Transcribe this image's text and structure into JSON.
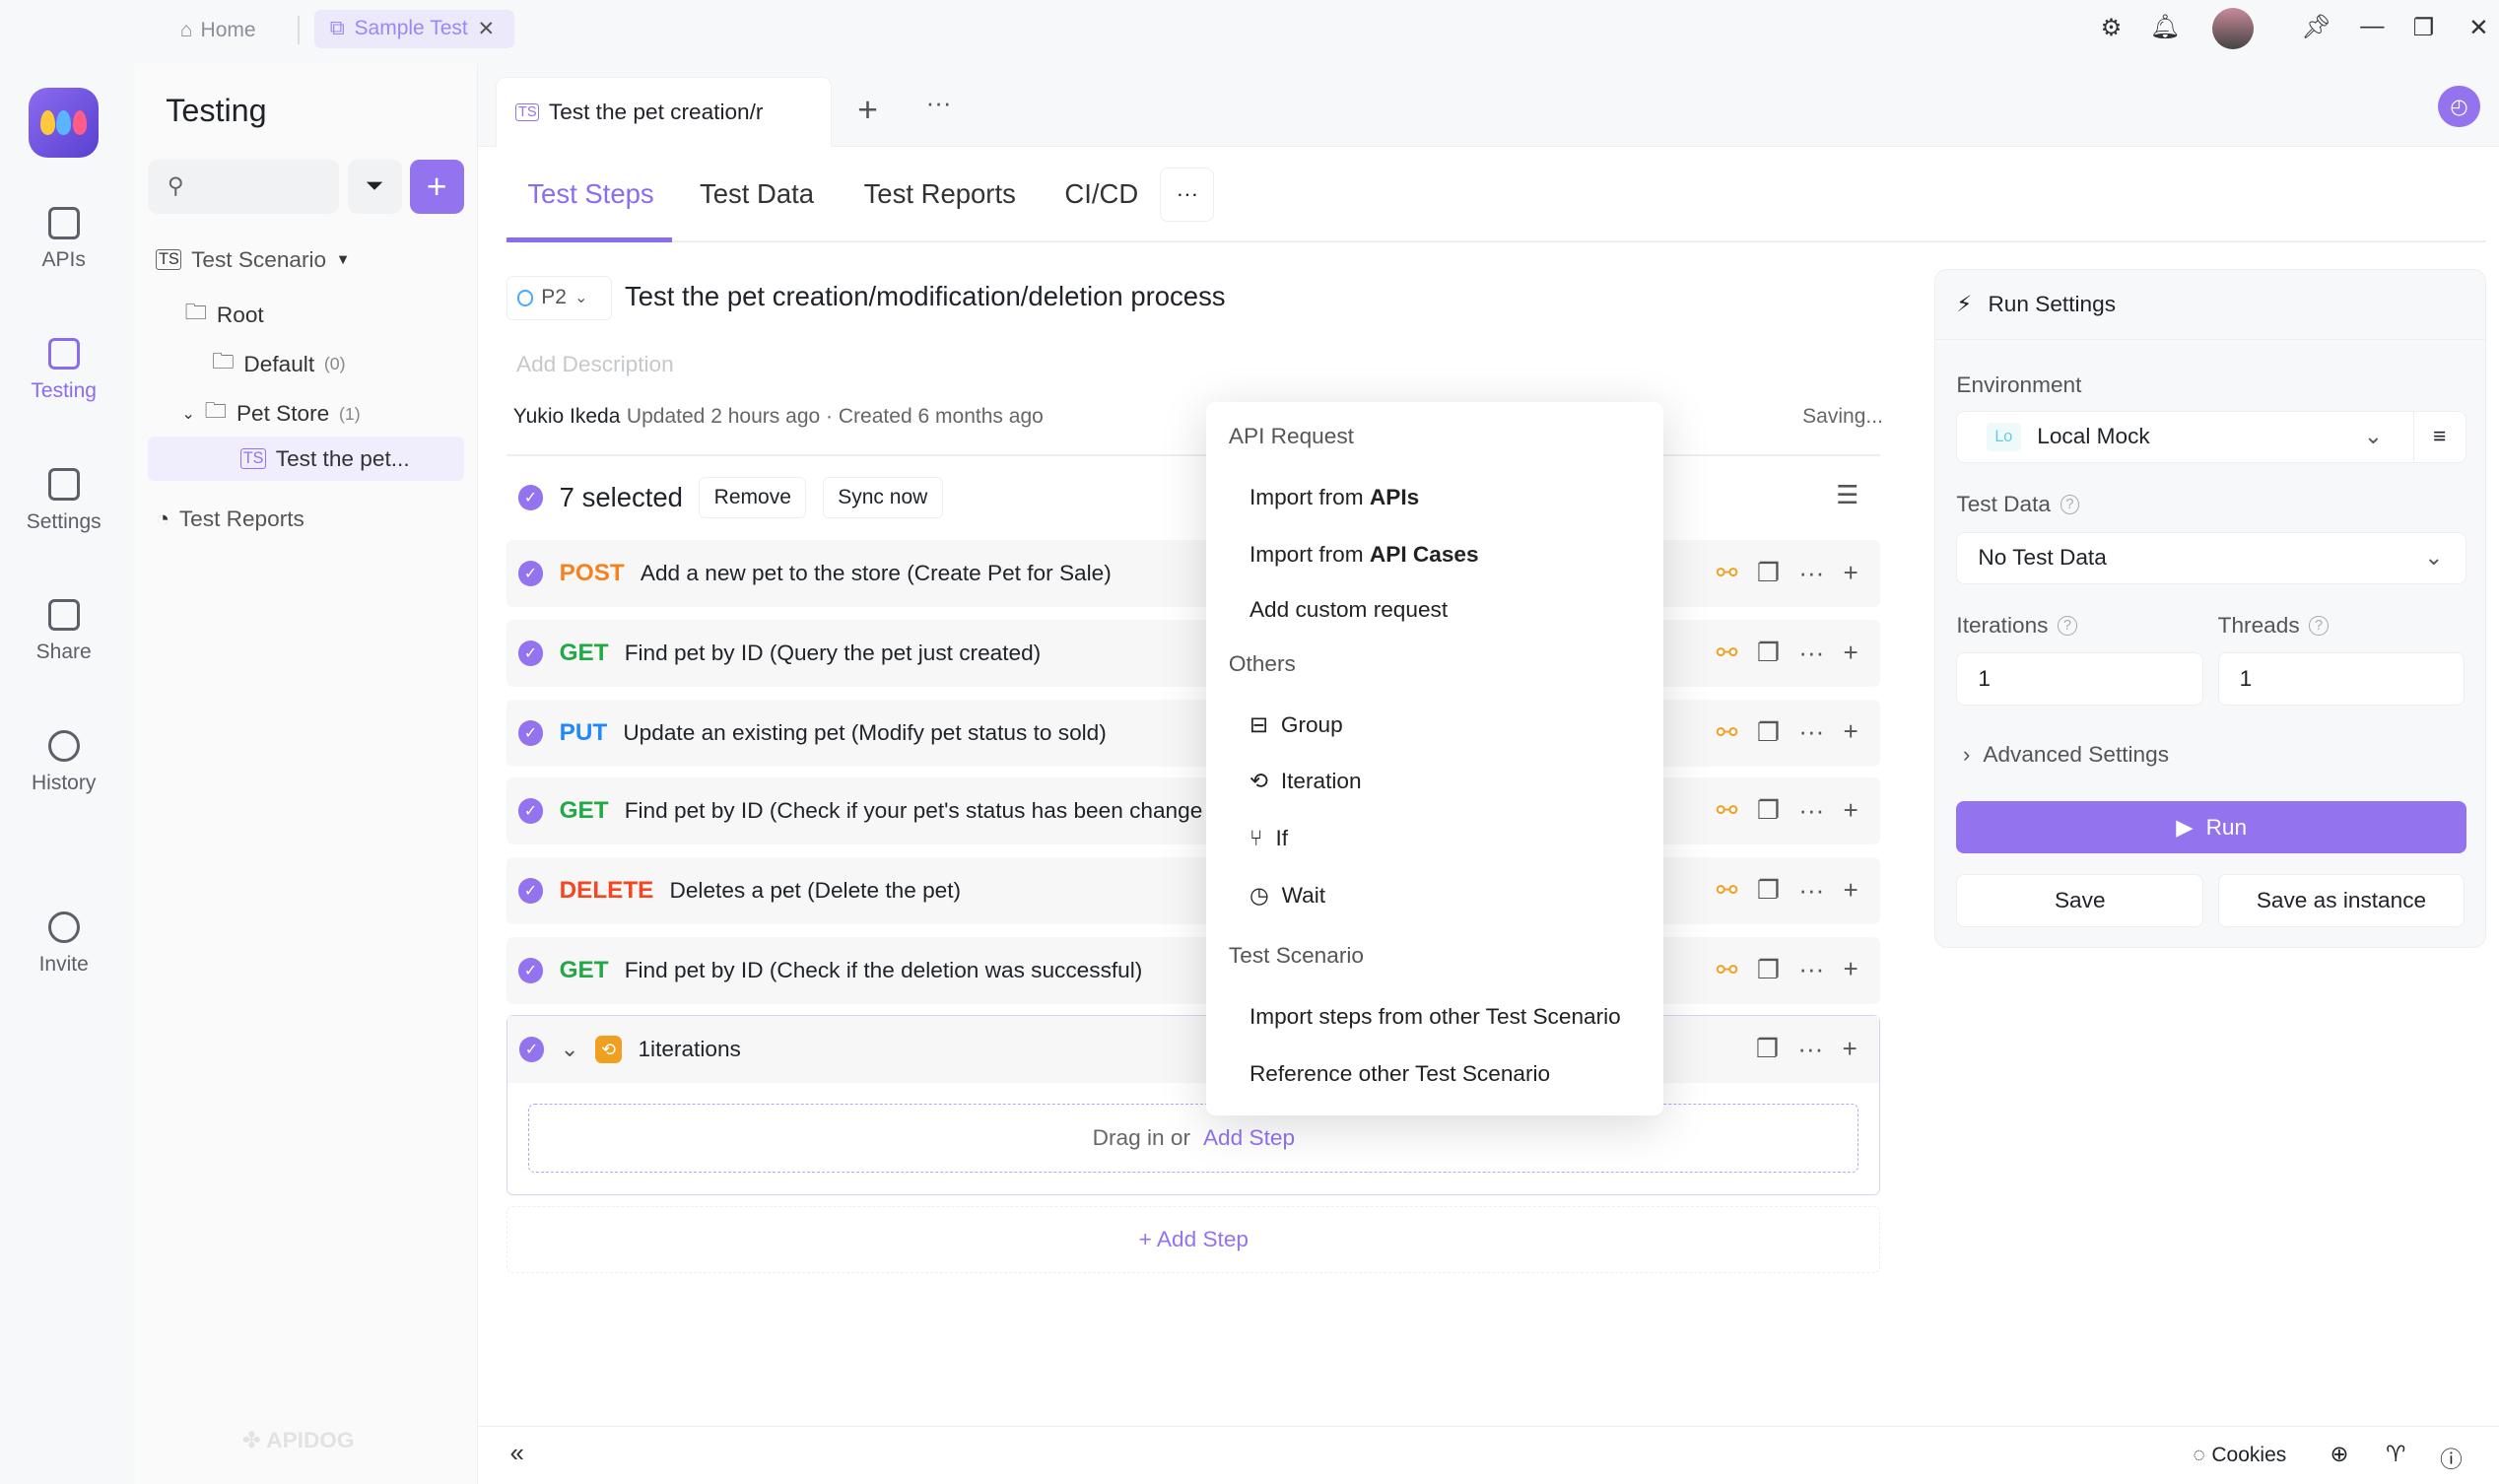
{
  "topbar": {
    "home_label": "Home",
    "open_tab": "Sample Test",
    "icons": [
      "settings-icon",
      "bell-icon",
      "avatar",
      "pin-icon",
      "minimize-icon",
      "restore-icon",
      "close-icon"
    ]
  },
  "rail": {
    "items": [
      {
        "label": "APIs",
        "icon": "apis-icon"
      },
      {
        "label": "Testing",
        "icon": "testing-icon",
        "active": true
      },
      {
        "label": "Settings",
        "icon": "settings-icon"
      },
      {
        "label": "Share",
        "icon": "share-icon"
      },
      {
        "label": "History",
        "icon": "history-icon"
      },
      {
        "label": "Invite",
        "icon": "invite-icon"
      }
    ]
  },
  "sidebar": {
    "title": "Testing",
    "search_placeholder": "",
    "tree": {
      "scenario": "Test Scenario",
      "root": "Root",
      "default": "Default",
      "default_count": "(0)",
      "petstore": "Pet Store",
      "petstore_count": "(1)",
      "selected": "Test the pet...",
      "reports": "Test Reports"
    },
    "watermark": "APIDOG"
  },
  "doc_tab": {
    "title": "Test the pet creation/r"
  },
  "subtabs": [
    "Test Steps",
    "Test Data",
    "Test Reports",
    "CI/CD"
  ],
  "scenario": {
    "priority": "P2",
    "title": "Test the pet creation/modification/deletion process",
    "description_placeholder": "Add Description",
    "author": "Yukio Ikeda",
    "updated": "Updated 2 hours ago · Created 6 months ago",
    "status": "Saving..."
  },
  "selection": {
    "count_label": "7 selected",
    "remove": "Remove",
    "sync": "Sync now"
  },
  "steps": [
    {
      "method": "POST",
      "color": "#f58220",
      "text": "Add a new pet to the store (Create Pet for Sale)"
    },
    {
      "method": "GET",
      "color": "#22a845",
      "text": "Find pet by ID (Query the pet just created)"
    },
    {
      "method": "PUT",
      "color": "#1e88ff",
      "text": "Update an existing pet (Modify pet status to sold)"
    },
    {
      "method": "GET",
      "color": "#22a845",
      "text": "Find pet by ID (Check if your pet's status has been change"
    },
    {
      "method": "DELETE",
      "color": "#f5461f",
      "text": "Deletes a pet (Delete the pet)"
    },
    {
      "method": "GET",
      "color": "#22a845",
      "text": "Find pet by ID (Check if the deletion was successful)"
    }
  ],
  "iteration": {
    "label": "1iterations",
    "drop_text": "Drag in or",
    "add_step": "Add Step"
  },
  "add_step": "+ Add Step",
  "menu": {
    "h1": "API Request",
    "i1a": "Import from ",
    "i1b": "APIs",
    "i2a": "Import from ",
    "i2b": "API Cases",
    "i3": "Add custom request",
    "h2": "Others",
    "group": "Group",
    "iteration": "Iteration",
    "if": "If",
    "wait": "Wait",
    "h3": "Test Scenario",
    "i4": "Import steps from other Test Scenario",
    "i5": "Reference other Test Scenario"
  },
  "run": {
    "title": "Run Settings",
    "env_label": "Environment",
    "env_badge": "Lo",
    "env_value": "Local Mock",
    "testdata_label": "Test Data",
    "testdata_value": "No Test Data",
    "iter_label": "Iterations",
    "iter_value": "1",
    "threads_label": "Threads",
    "threads_value": "1",
    "advanced": "Advanced Settings",
    "run": "Run",
    "save": "Save",
    "save_instance": "Save as instance"
  },
  "bottom": {
    "cookies": "Cookies"
  },
  "colors": {
    "accent": "#9373ee"
  }
}
